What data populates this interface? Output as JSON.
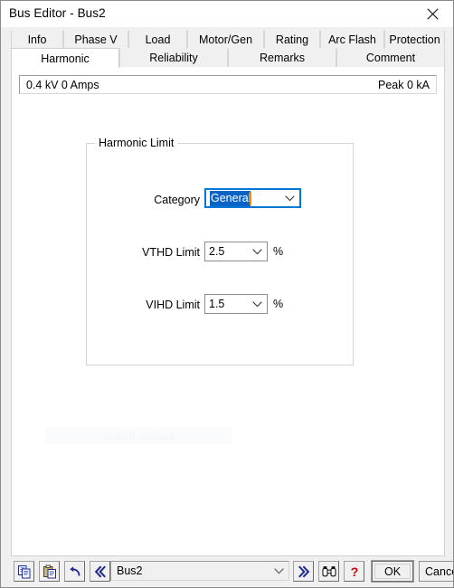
{
  "window": {
    "title": "Bus Editor - Bus2",
    "close_label": "Close"
  },
  "tabs": {
    "row1": [
      {
        "label": "Info",
        "active": false
      },
      {
        "label": "Phase V",
        "active": false
      },
      {
        "label": "Load",
        "active": false
      },
      {
        "label": "Motor/Gen",
        "active": false
      },
      {
        "label": "Rating",
        "active": false
      },
      {
        "label": "Arc Flash",
        "active": false
      },
      {
        "label": "Protection",
        "active": false
      }
    ],
    "row2": [
      {
        "label": "Harmonic",
        "active": true
      },
      {
        "label": "Reliability",
        "active": false
      },
      {
        "label": "Remarks",
        "active": false
      },
      {
        "label": "Comment",
        "active": false
      }
    ]
  },
  "info_strip": {
    "left": "0.4 kV 0 Amps",
    "right": "Peak 0 kA"
  },
  "harmonic_limit": {
    "group_title": "Harmonic Limit",
    "category": {
      "label": "Category",
      "value": "General"
    },
    "vthd": {
      "label": "VTHD Limit",
      "value": "2.5",
      "unit": "%"
    },
    "vihd": {
      "label": "VIHD Limit",
      "value": "1.5",
      "unit": "%"
    }
  },
  "watermark": {
    "text": "قصاصة النافذة"
  },
  "footer": {
    "copy_title": "Copy",
    "paste_title": "Paste",
    "undo_title": "Undo",
    "prev_title": "Previous",
    "next_title": "Next",
    "find_title": "Find",
    "help_title": "Help",
    "bus_selector": {
      "value": "Bus2"
    },
    "ok_label": "OK",
    "cancel_label": "Cancel"
  },
  "colors": {
    "accent": "#0078d7",
    "selection": "#0a64c8",
    "caret": "#ff8c00",
    "navy": "#1f2a8c",
    "help_red": "#d40000"
  }
}
